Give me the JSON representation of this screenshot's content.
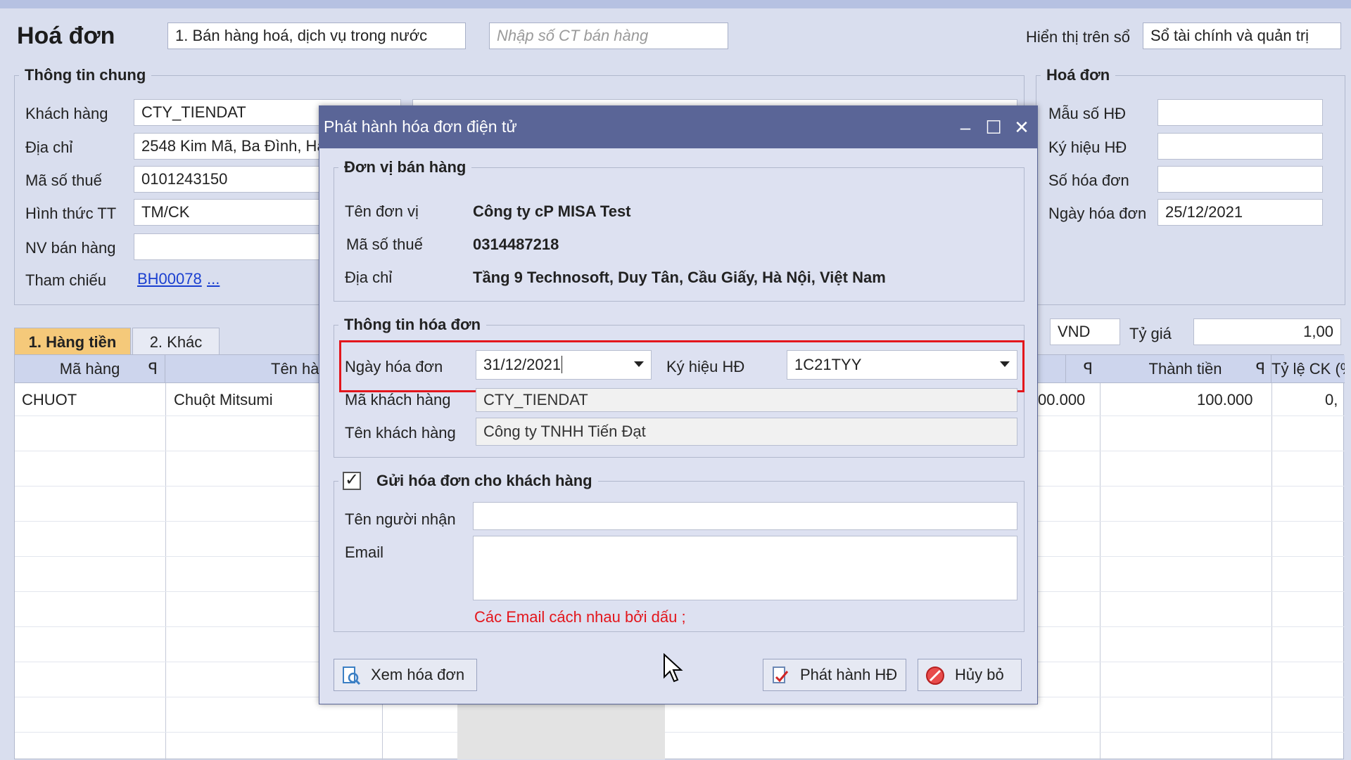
{
  "window": {
    "title": "Hoá đơn",
    "type_combo": "1. Bán hàng hoá, dịch vụ trong nước",
    "doc_no_placeholder": "Nhập số CT bán hàng",
    "display_label": "Hiển thị trên sổ",
    "display_value": "Sổ tài chính và quản trị"
  },
  "general": {
    "legend": "Thông tin chung",
    "customer_label": "Khách hàng",
    "customer_value": "CTY_TIENDAT",
    "address_label": "Địa chỉ",
    "address_value": "2548 Kim Mã, Ba Đình, Hà",
    "tax_label": "Mã số thuế",
    "tax_value": "0101243150",
    "payment_label": "Hình thức TT",
    "payment_value": "TM/CK",
    "staff_label": "NV bán hàng",
    "staff_value": "",
    "ref_label": "Tham chiếu",
    "ref_value": "BH00078",
    "ref_more": "..."
  },
  "invoice": {
    "legend": "Hoá đơn",
    "form_label": "Mẫu số HĐ",
    "form_value": "",
    "symbol_label": "Ký hiệu HĐ",
    "symbol_value": "",
    "number_label": "Số hóa đơn",
    "number_value": "",
    "date_label": "Ngày hóa đơn",
    "date_value": "25/12/2021"
  },
  "currency": {
    "code": "VND",
    "rate_label": "Tỷ giá",
    "rate_value": "1,00"
  },
  "tabs": [
    {
      "label": "1. Hàng tiền"
    },
    {
      "label": "2. Khác"
    }
  ],
  "grid": {
    "headers": {
      "code": "Mã hàng",
      "name": "Tên hà",
      "amount": "Thành tiền",
      "discount": "Tỷ lệ CK (%)"
    },
    "rows": [
      {
        "code": "CHUOT",
        "name": "Chuột Mitsumi",
        "price": "00.000",
        "amount": "100.000",
        "discount": "0,"
      }
    ]
  },
  "dialog": {
    "title": "Phát hành hóa đơn điện tử",
    "seller": {
      "legend": "Đơn vị bán hàng",
      "name_label": "Tên đơn vị",
      "name_value": "Công ty cP MISA Test",
      "tax_label": "Mã số thuế",
      "tax_value": "0314487218",
      "address_label": "Địa chỉ",
      "address_value": "Tầng 9 Technosoft, Duy Tân, Cầu Giấy, Hà Nội, Việt Nam"
    },
    "info": {
      "legend": "Thông tin hóa đơn",
      "date_label": "Ngày hóa đơn",
      "date_value": "31/12/2021",
      "symbol_label": "Ký hiệu HĐ",
      "symbol_value": "1C21TYY",
      "cust_code_label": "Mã khách hàng",
      "cust_code_value": "CTY_TIENDAT",
      "cust_name_label": "Tên khách hàng",
      "cust_name_value": "Công ty TNHH Tiến Đạt"
    },
    "send": {
      "legend": "Gửi hóa đơn cho khách hàng",
      "checked": true,
      "recipient_label": "Tên người nhận",
      "recipient_value": "",
      "email_label": "Email",
      "email_value": "",
      "hint": "Các Email cách nhau bởi dấu ;"
    },
    "buttons": {
      "view": "Xem hóa đơn",
      "issue": "Phát hành HĐ",
      "cancel": "Hủy bỏ"
    }
  },
  "colors": {
    "highlight": "#e3161c",
    "titlebar": "#5a6597",
    "link": "#1a3fd0"
  }
}
